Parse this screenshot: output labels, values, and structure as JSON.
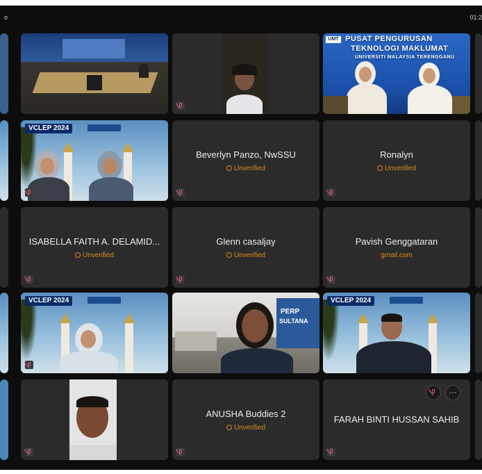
{
  "window": {
    "left_indicator": "o",
    "clock": "01:2"
  },
  "participants": [
    {
      "id": "p1",
      "type": "video",
      "scene": "conference-room"
    },
    {
      "id": "p2",
      "type": "video",
      "scene": "girl-dark"
    },
    {
      "id": "p3",
      "type": "video",
      "scene": "pusat",
      "text_line1": "PUSAT PENGURUSAN",
      "text_line2": "TEKNOLOGI MAKLUMAT",
      "text_line3": "UNIVERSITI MALAYSIA TERENGGANU",
      "logo": "UMT"
    },
    {
      "id": "p4",
      "type": "video",
      "scene": "vclep-two-women",
      "banner": "VCLEP 2024"
    },
    {
      "id": "p5",
      "type": "audio",
      "name": "Beverlyn Panzo, NwSSU",
      "status": "Unverified"
    },
    {
      "id": "p6",
      "type": "audio",
      "name": "Ronalyn",
      "status": "Unverified"
    },
    {
      "id": "p7",
      "type": "audio",
      "name": "ISABELLA FAITH A. DELAMID...",
      "status": "Unverified"
    },
    {
      "id": "p8",
      "type": "audio",
      "name": "Glenn casaljay",
      "status": "Unverified"
    },
    {
      "id": "p9",
      "type": "audio",
      "name": "Pavish Genggataran",
      "status": "gmail.com"
    },
    {
      "id": "p10",
      "type": "video",
      "scene": "vclep-woman-glasses",
      "banner": "VCLEP 2024"
    },
    {
      "id": "p11",
      "type": "video",
      "scene": "library-woman",
      "wall_text1": "PERP",
      "wall_text2": "SULTANA"
    },
    {
      "id": "p12",
      "type": "video",
      "scene": "vclep-man",
      "banner": "VCLEP 2024"
    },
    {
      "id": "p13",
      "type": "video",
      "scene": "man-white-wall"
    },
    {
      "id": "p14",
      "type": "audio",
      "name": "ANUSHA Buddies 2",
      "status": "Unverified"
    },
    {
      "id": "p15",
      "type": "audio",
      "name": "FARAH BINTI HUSSAN SAHIB",
      "status": ""
    }
  ],
  "tile_controls": {
    "mute_icon": "mic-off-icon",
    "more_label": "···"
  },
  "colors": {
    "tile_bg": "#2b2b2b",
    "unverified": "#d98c1b",
    "stage_bg": "#0d0d0d"
  }
}
